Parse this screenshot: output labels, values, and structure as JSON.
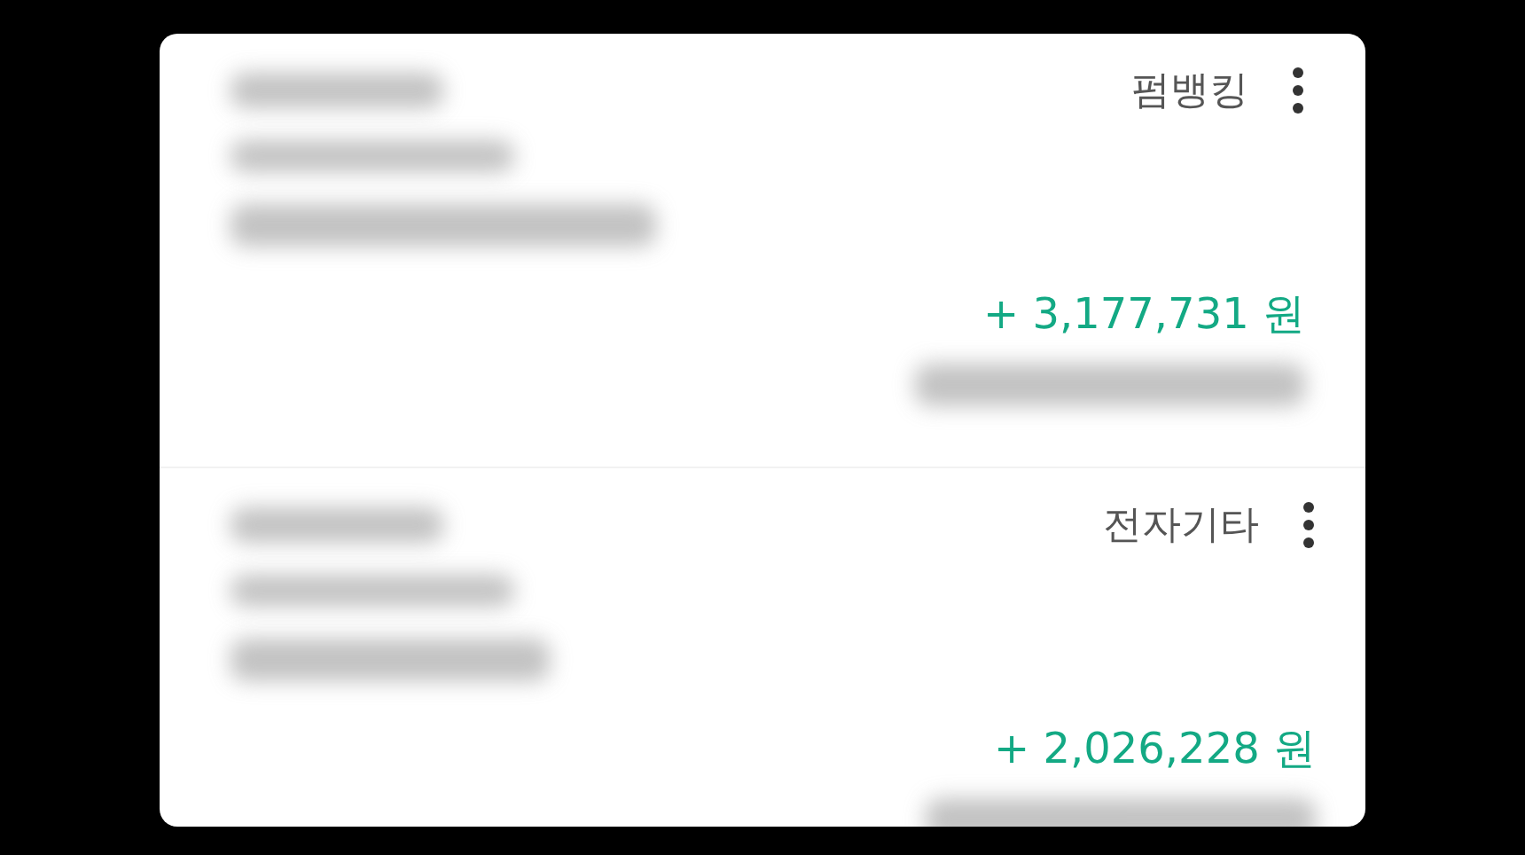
{
  "transactions": [
    {
      "category": "펌뱅킹",
      "amount": "+ 3,177,731 원"
    },
    {
      "category": "전자기타",
      "amount": "+ 2,026,228 원"
    }
  ]
}
